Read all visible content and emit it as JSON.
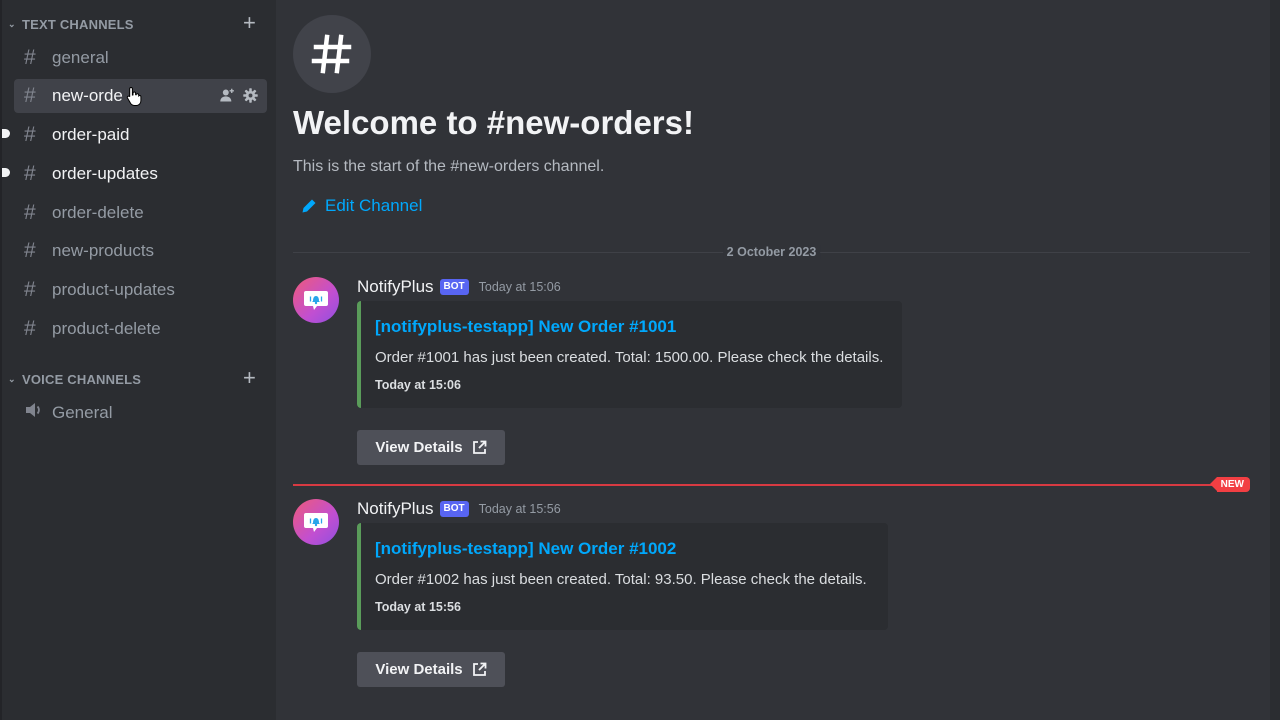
{
  "sidebar": {
    "text_category": {
      "label": "TEXT CHANNELS",
      "add_icon": "plus-icon"
    },
    "text_channels": [
      {
        "name": "general",
        "state": "read"
      },
      {
        "name": "new-orders",
        "display": "new-orde",
        "state": "active"
      },
      {
        "name": "order-paid",
        "state": "unread"
      },
      {
        "name": "order-updates",
        "state": "unread"
      },
      {
        "name": "order-delete",
        "state": "read"
      },
      {
        "name": "new-products",
        "state": "read"
      },
      {
        "name": "product-updates",
        "state": "read"
      },
      {
        "name": "product-delete",
        "state": "read"
      }
    ],
    "voice_category": {
      "label": "VOICE CHANNELS",
      "add_icon": "plus-icon"
    },
    "voice_channels": [
      {
        "name": "General"
      }
    ],
    "channel_hash": "#"
  },
  "main": {
    "welcome_icon": "#",
    "welcome_title": "Welcome to #new-orders!",
    "welcome_subtitle": "This is the start of the #new-orders channel.",
    "edit_channel": "Edit Channel",
    "date_divider": "2 October 2023",
    "new_badge": "NEW",
    "messages": [
      {
        "author": "NotifyPlus",
        "tag": "BOT",
        "timestamp": "Today at 15:06",
        "embed": {
          "title": "[notifyplus-testapp] New Order #1001",
          "description": "Order #1001 has just been created. Total: 1500.00. Please check the details.",
          "footer": "Today at 15:06"
        },
        "button": "View Details"
      },
      {
        "author": "NotifyPlus",
        "tag": "BOT",
        "timestamp": "Today at 15:56",
        "embed": {
          "title": "[notifyplus-testapp] New Order #1002",
          "description": "Order #1002 has just been created. Total: 93.50. Please check the details.",
          "footer": "Today at 15:56"
        },
        "button": "View Details"
      }
    ]
  },
  "colors": {
    "link": "#00a8fc",
    "bot_tag": "#5865f2",
    "new_divider": "#f23f43",
    "embed_accent": "#5a9c5a"
  }
}
